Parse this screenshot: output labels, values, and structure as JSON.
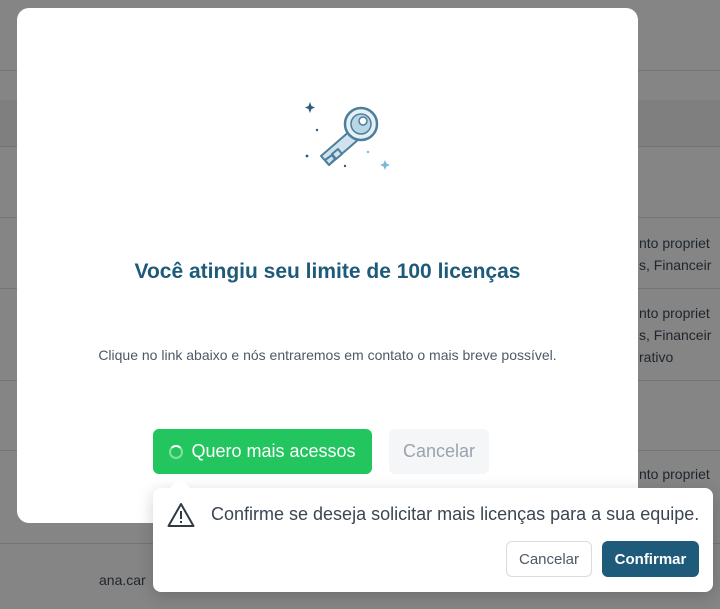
{
  "background": {
    "cells": [
      "nto propriet",
      "s, Financeir",
      "nto propriet",
      "s, Financeir",
      "rativo",
      "nto propriet",
      "ana.car"
    ]
  },
  "modal": {
    "icon": "key-icon",
    "title": "Você atingiu seu limite de 100 licenças",
    "description": "Clique no link abaixo e nós entraremos em contato o mais breve possível.",
    "primary_button": "Quero mais acessos",
    "cancel_button": "Cancelar",
    "primary_color": "#22c55e",
    "title_color": "#1e5a7a"
  },
  "popconfirm": {
    "icon": "warning-icon",
    "message": "Confirme se deseja solicitar mais licenças para a sua equipe.",
    "cancel_label": "Cancelar",
    "confirm_label": "Confirmar",
    "confirm_color": "#1e5a7a"
  }
}
